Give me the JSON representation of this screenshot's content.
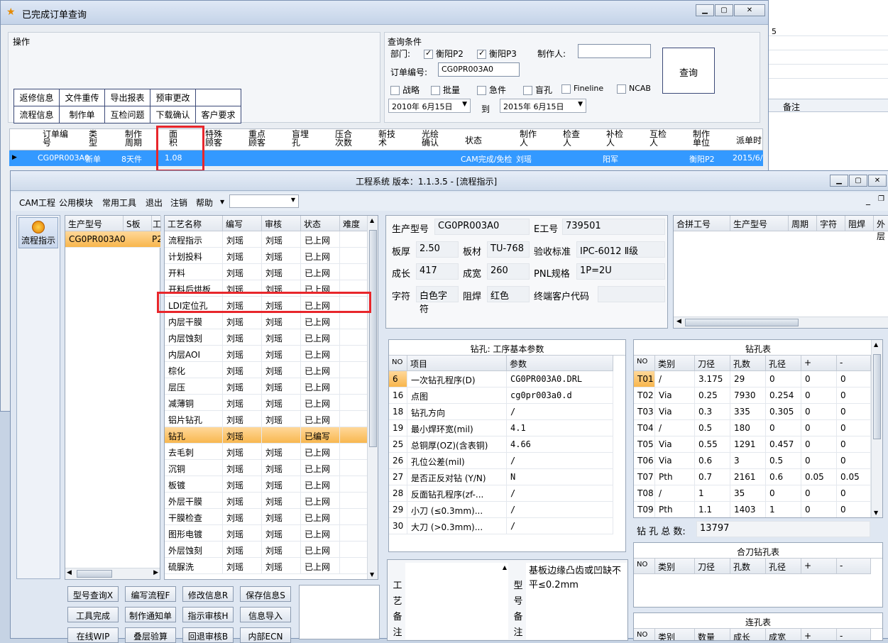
{
  "win1": {
    "title": "已完成订单查询",
    "ops_label": "操作",
    "ops": [
      [
        "返修信息",
        "文件重传",
        "导出报表",
        "预审更改",
        ""
      ],
      [
        "流程信息",
        "制作单",
        "互检问题",
        "下载确认",
        "客户要求"
      ]
    ],
    "query": {
      "label": "查询条件",
      "dept_label": "部门:",
      "dept1": "衡阳P2",
      "dept2": "衡阳P3",
      "maker_label": "制作人:",
      "order_label": "订单编号:",
      "order_value": "CG0PR003A0",
      "checks": [
        "战略",
        "批量",
        "急件",
        "盲孔",
        "Fineline",
        "NCAB"
      ],
      "date_from": "2010年 6月15日",
      "to_label": "到",
      "date_to": "2015年 6月15日",
      "button": "查询"
    },
    "grid": {
      "headers": [
        "订单编\n号",
        "类\n型",
        "制作\n周期",
        "面\n积",
        "特殊\n顾客",
        "重点\n顾客",
        "盲埋\n孔",
        "压合\n次数",
        "新技\n术",
        "光绘\n确认",
        "状态",
        "制作\n人",
        "检查\n人",
        "补检\n人",
        "互检\n人",
        "制作\n单位",
        "派单时"
      ],
      "row": [
        "CG0PR003A0",
        "新单",
        "8天件",
        "1.08",
        "",
        "",
        "",
        "",
        "",
        "",
        "CAM完成/免检",
        "刘瑶",
        "",
        "阳军",
        "",
        "衡阳P2",
        "2015/6/"
      ]
    }
  },
  "bg": {
    "num": "5",
    "remark": "备注"
  },
  "win2": {
    "title": "工程系统  版本：1.1.3.5 - [流程指示]",
    "menu": [
      "CAM工程",
      "公用模块",
      "常用工具",
      "退出",
      "注销",
      "帮助"
    ],
    "side_button": "流程指示",
    "products": {
      "h1": "生产型号",
      "h2": "S板",
      "h3": "工",
      "row": "CG0PR003A0",
      "row2": "P2"
    },
    "process": {
      "headers": [
        "工艺名称",
        "编写",
        "审核",
        "状态",
        "难度"
      ],
      "rows": [
        [
          "流程指示",
          "刘瑶",
          "刘瑶",
          "已上网"
        ],
        [
          "计划投料",
          "刘瑶",
          "刘瑶",
          "已上网"
        ],
        [
          "开料",
          "刘瑶",
          "刘瑶",
          "已上网"
        ],
        [
          "开料后烘板",
          "刘瑶",
          "刘瑶",
          "已上网"
        ],
        [
          "LDI定位孔",
          "刘瑶",
          "刘瑶",
          "已上网"
        ],
        [
          "内层干膜",
          "刘瑶",
          "刘瑶",
          "已上网"
        ],
        [
          "内层蚀刻",
          "刘瑶",
          "刘瑶",
          "已上网"
        ],
        [
          "内层AOI",
          "刘瑶",
          "刘瑶",
          "已上网"
        ],
        [
          "棕化",
          "刘瑶",
          "刘瑶",
          "已上网"
        ],
        [
          "层压",
          "刘瑶",
          "刘瑶",
          "已上网"
        ],
        [
          "减薄铜",
          "刘瑶",
          "刘瑶",
          "已上网"
        ],
        [
          "铝片钻孔",
          "刘瑶",
          "刘瑶",
          "已上网"
        ],
        [
          "钻孔",
          "刘瑶",
          "",
          "已编写"
        ],
        [
          "去毛刺",
          "刘瑶",
          "刘瑶",
          "已上网"
        ],
        [
          "沉铜",
          "刘瑶",
          "刘瑶",
          "已上网"
        ],
        [
          "板镀",
          "刘瑶",
          "刘瑶",
          "已上网"
        ],
        [
          "外层干膜",
          "刘瑶",
          "刘瑶",
          "已上网"
        ],
        [
          "干膜检查",
          "刘瑶",
          "刘瑶",
          "已上网"
        ],
        [
          "图形电镀",
          "刘瑶",
          "刘瑶",
          "已上网"
        ],
        [
          "外层蚀刻",
          "刘瑶",
          "刘瑶",
          "已上网"
        ],
        [
          "硫脲洗",
          "刘瑶",
          "刘瑶",
          "已上网"
        ]
      ]
    },
    "info": {
      "model_label": "生产型号",
      "model": "CG0PR003A0",
      "e_label": "E工号",
      "e": "739501",
      "thick_label": "板厚",
      "thick": "2.50",
      "mat_label": "板材",
      "mat": "TU-768",
      "std_label": "验收标准",
      "std": "IPC-6012 Ⅱ级",
      "len_label": "成长",
      "len": "417",
      "wid_label": "成宽",
      "wid": "260",
      "pnl_label": "PNL规格",
      "pnl": "1P=2U",
      "char_label": "字符",
      "char": "白色字符",
      "mask_label": "阻焊",
      "mask": "红色",
      "cust_label": "终端客户代码"
    },
    "combo": {
      "headers": [
        "合拼工号",
        "生产型号",
        "周期",
        "字符",
        "阻焊",
        "外层"
      ]
    },
    "drill": {
      "title": "钻孔: 工序基本参数",
      "h1": "NO",
      "h2": "项目",
      "h3": "参数",
      "rows": [
        [
          "6",
          "一次钻孔程序(D)",
          "CG0PR003A0.DRL"
        ],
        [
          "16",
          "点图",
          "cg0pr003a0.d"
        ],
        [
          "18",
          "钻孔方向",
          "/"
        ],
        [
          "19",
          "最小焊环宽(mil)",
          "4.1"
        ],
        [
          "25",
          "总铜厚(OZ)(含表铜)",
          "4.66"
        ],
        [
          "26",
          "孔位公差(mil)",
          "/"
        ],
        [
          "27",
          "是否正反对钻 (Y/N)",
          "N"
        ],
        [
          "28",
          "反面钻孔程序(zf-...",
          "/"
        ],
        [
          "29",
          "小刀 (≤0.3mm)...",
          "/"
        ],
        [
          "30",
          "大刀 (>0.3mm)...",
          "/"
        ]
      ]
    },
    "holes": {
      "title": "钻孔表",
      "headers": [
        "NO",
        "类别",
        "刀径",
        "孔数",
        "孔径",
        "+",
        "-"
      ],
      "rows": [
        [
          "T01",
          "/",
          "3.175",
          "29",
          "0",
          "0",
          "0"
        ],
        [
          "T02",
          "Via",
          "0.25",
          "7930",
          "0.254",
          "0",
          "0"
        ],
        [
          "T03",
          "Via",
          "0.3",
          "335",
          "0.305",
          "0",
          "0"
        ],
        [
          "T04",
          "/",
          "0.5",
          "180",
          "0",
          "0",
          "0"
        ],
        [
          "T05",
          "Via",
          "0.55",
          "1291",
          "0.457",
          "0",
          "0"
        ],
        [
          "T06",
          "Via",
          "0.6",
          "3",
          "0.5",
          "0",
          "0"
        ],
        [
          "T07",
          "Pth",
          "0.7",
          "2161",
          "0.6",
          "0.05",
          "0.05"
        ],
        [
          "T08",
          "/",
          "1",
          "35",
          "0",
          "0",
          "0"
        ],
        [
          "T09",
          "Pth",
          "1.1",
          "1403",
          "1",
          "0",
          "0"
        ]
      ],
      "total_label": "钻 孔 总 数:",
      "total": "13797"
    },
    "combo_drill": {
      "title": "合刀钻孔表",
      "headers": [
        "NO",
        "类别",
        "刀径",
        "孔数",
        "孔径",
        "+",
        "-"
      ]
    },
    "slot": {
      "title": "连孔表",
      "headers": [
        "NO",
        "类别",
        "数量",
        "成长mm",
        "成宽mm",
        "+",
        "-"
      ]
    },
    "remarks": {
      "proc_label": "工艺备注",
      "model_label": "型号备注",
      "model_text": "基板边缘凸齿或凹缺不平≤0.2mm"
    },
    "buttons": [
      [
        "型号查询X",
        "编写流程F",
        "修改信息R",
        "保存信息S"
      ],
      [
        "工具完成",
        "制作通知单",
        "指示审核H",
        "信息导入"
      ],
      [
        "在线WIP",
        "叠层验算",
        "回退审核B",
        "内部ECN"
      ]
    ]
  }
}
